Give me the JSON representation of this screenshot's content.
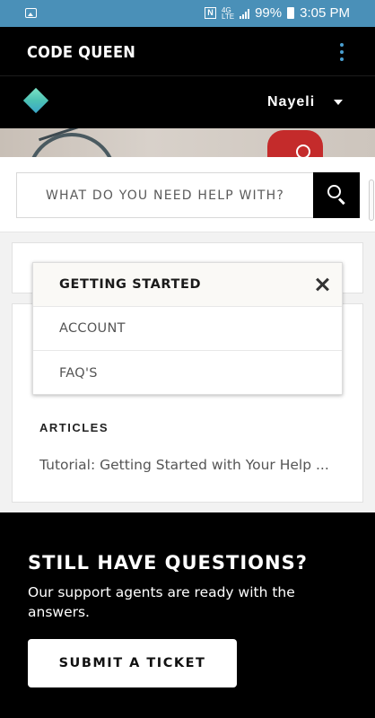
{
  "status_bar": {
    "battery": "99%",
    "time": "3:05 PM"
  },
  "app_bar": {
    "title": "CODE QUEEN"
  },
  "brand_bar": {
    "user_name": "Nayeli",
    "logo_color": "#4cc2b4"
  },
  "search": {
    "placeholder": "WHAT DO YOU NEED HELP WITH?"
  },
  "dropdown": {
    "items": [
      {
        "label": "GETTING STARTED",
        "selected": true
      },
      {
        "label": "ACCOUNT"
      },
      {
        "label": "FAQ'S"
      }
    ]
  },
  "articles": {
    "heading": "ARTICLES",
    "items": [
      {
        "title": "Tutorial: Getting Started with Your Help ..."
      }
    ]
  },
  "footer": {
    "title": "STILL HAVE QUESTIONS?",
    "text": "Our support agents are ready with the answers.",
    "button_label": "SUBMIT A TICKET"
  }
}
